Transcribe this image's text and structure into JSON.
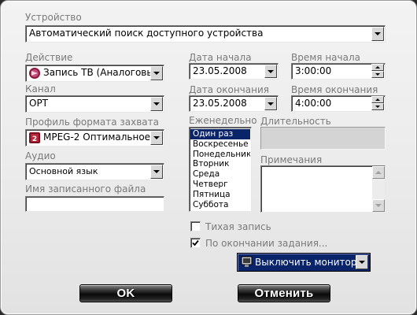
{
  "dialog": {
    "device": {
      "label": "Устройство",
      "value": "Автоматический поиск доступного устройства"
    },
    "action": {
      "label": "Действие",
      "value": "Запись ТВ (Аналоговый",
      "icon": "tv-record-icon"
    },
    "channel": {
      "label": "Канал",
      "value": "ОРТ"
    },
    "capture_profile": {
      "label": "Профиль формата захвата",
      "value": "MPEG-2 Оптимальное к",
      "icon": "mpeg2-profile-icon"
    },
    "audio": {
      "label": "Аудио",
      "value": "Основной язык"
    },
    "filename": {
      "label": "Имя записанного файла",
      "value": ""
    },
    "start_date": {
      "label": "Дата начала",
      "value": "23.05.2008"
    },
    "start_time": {
      "label": "Время начала",
      "value": "3:00:00"
    },
    "end_date": {
      "label": "Дата окончания",
      "value": "23.05.2008"
    },
    "end_time": {
      "label": "Время окончания",
      "value": "4:00:00"
    },
    "weekly": {
      "label": "Еженедельно",
      "items": [
        "Один раз",
        "Воскресенье",
        "Понедельник",
        "Вторник",
        "Среда",
        "Четверг",
        "Пятница",
        "Суббота"
      ],
      "selected": "Один раз"
    },
    "duration": {
      "label": "Длительность",
      "value": ""
    },
    "notes": {
      "label": "Примечания",
      "value": ""
    },
    "silent_record": {
      "label": "Тихая запись",
      "checked": false
    },
    "on_finish": {
      "label": "По окончании задания...",
      "checked": true
    },
    "finish_action": {
      "value": "Выключить монитор",
      "icon": "monitor-icon"
    },
    "buttons": {
      "ok": "OK",
      "cancel": "Отменить"
    }
  },
  "colors": {
    "selection": "#0a246a",
    "label_gray": "#7a7a7a",
    "button_black": "#0b0b0b"
  }
}
